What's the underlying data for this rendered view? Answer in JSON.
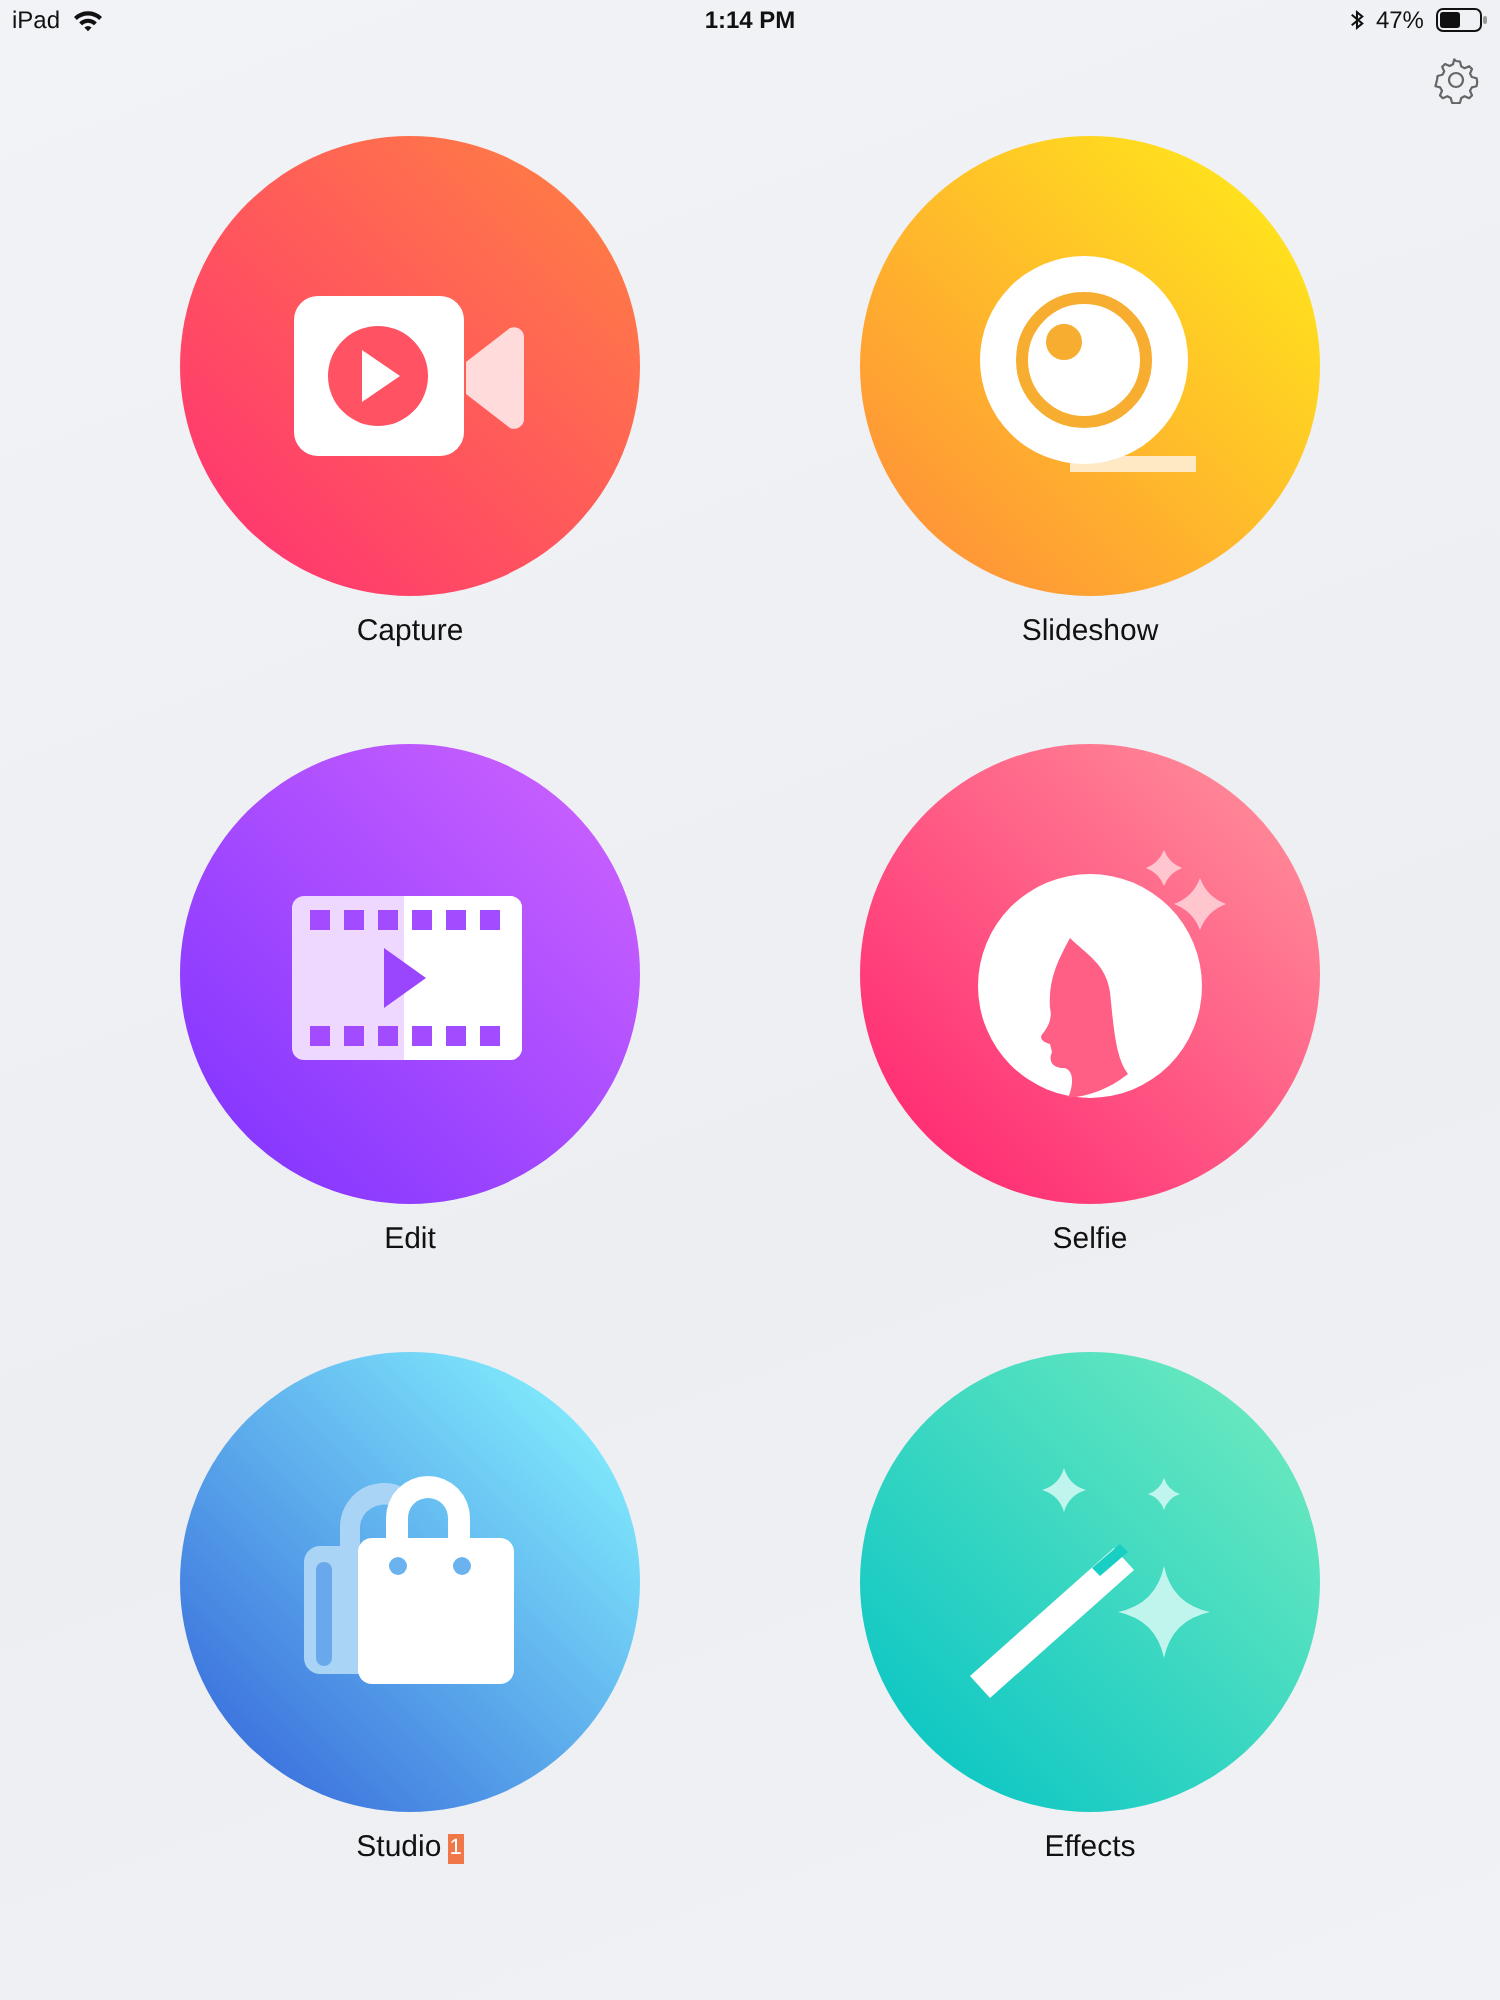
{
  "status_bar": {
    "device": "iPad",
    "time": "1:14 PM",
    "battery_percent": "47%"
  },
  "tiles": [
    {
      "kind": "capture",
      "label": "Capture"
    },
    {
      "kind": "slideshow",
      "label": "Slideshow"
    },
    {
      "kind": "edit",
      "label": "Edit"
    },
    {
      "kind": "selfie",
      "label": "Selfie"
    },
    {
      "kind": "studio",
      "label": "Studio",
      "badge": "1"
    },
    {
      "kind": "effects",
      "label": "Effects"
    }
  ]
}
